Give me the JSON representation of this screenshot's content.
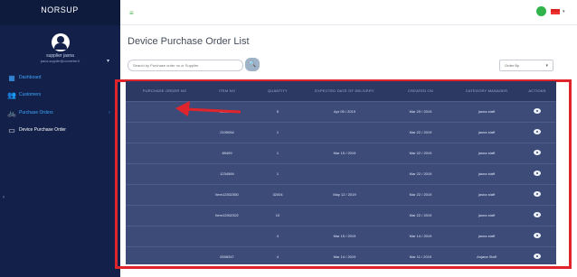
{
  "brand": {
    "logo": "NORSUP",
    "sub": ""
  },
  "user": {
    "name": "supplier jasna",
    "email": "jasna-supplier@conventer.lt"
  },
  "sidebar": {
    "items": [
      {
        "label": "Dashboard",
        "icon": "dashboard-icon",
        "glyph": "▦"
      },
      {
        "label": "Customers",
        "icon": "users-icon",
        "glyph": "👥"
      },
      {
        "label": "Purchase Orders",
        "icon": "orders-icon",
        "glyph": "🚲"
      },
      {
        "label": "Device Purchase Order",
        "icon": "device-icon",
        "glyph": "▭"
      }
    ],
    "side_arrow": "›"
  },
  "header": {
    "menu_glyph": "≡",
    "flag_caret": "▾"
  },
  "page": {
    "title": "Device Purchase Order List",
    "search_placeholder": "Search by Purchase order no or Supplier",
    "search_glyph": "🔍",
    "order_select": "Order By",
    "order_caret": "▾"
  },
  "table": {
    "headers": [
      "PURCHASE ORDER NO",
      "ITEM NO",
      "QUANTITY",
      "EXPECTED DATE OF DELIVERY",
      "CREATED ON",
      "CATEGORY MANAGER",
      "ACTIONS"
    ],
    "rows": [
      {
        "po": "",
        "item": "2193587",
        "qty": "5",
        "delivery": "Apr 05 / 2019",
        "created": "Mar 29 / 2019",
        "manager": "jasna staff"
      },
      {
        "po": "",
        "item": "2105064",
        "qty": "1",
        "delivery": "",
        "created": "Mar 22 / 2019",
        "manager": "jasna staff"
      },
      {
        "po": "",
        "item": "89499",
        "qty": "1",
        "delivery": "Mar 15 / 2019",
        "created": "Mar 22 / 2019",
        "manager": "jasna staff"
      },
      {
        "po": "",
        "item": "1234569",
        "qty": "1",
        "delivery": "",
        "created": "Mar 22 / 2019",
        "manager": "jasna staff"
      },
      {
        "po": "",
        "item": "Item12302350",
        "qty": "32004",
        "delivery": "May 12 / 2019",
        "created": "Mar 22 / 2019",
        "manager": "jasna staff"
      },
      {
        "po": "",
        "item": "Item12302322",
        "qty": "10",
        "delivery": "",
        "created": "Mar 22 / 2019",
        "manager": "jasna staff"
      },
      {
        "po": "",
        "item": "",
        "qty": "4",
        "delivery": "Mar 15 / 2019",
        "created": "Mar 14 / 2019",
        "manager": "jasna staff"
      },
      {
        "po": "",
        "item": "0008347",
        "qty": "4",
        "delivery": "Mar 14 / 2019",
        "created": "Mar 11 / 2019",
        "manager": "Anjana Staff"
      }
    ]
  },
  "colors": {
    "sidebar_bg": "#13214a",
    "accent_blue": "#3ea6ff",
    "table_bg": "#3d4b78",
    "po_green": "#4cd35a",
    "highlight_red": "#e0242b"
  }
}
